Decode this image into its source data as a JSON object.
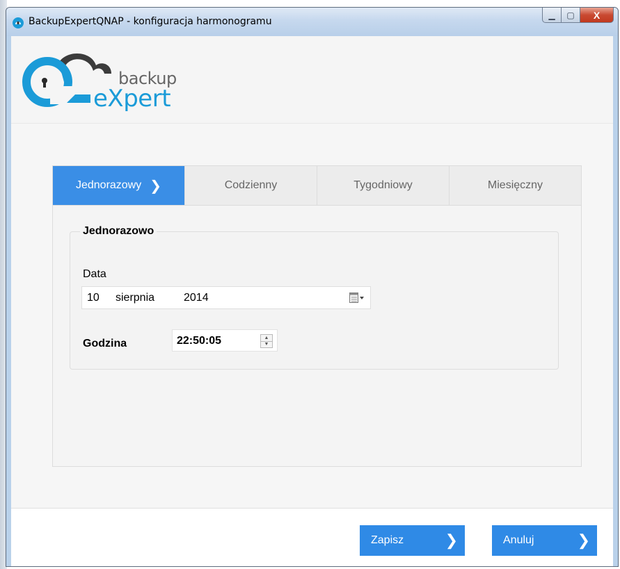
{
  "window": {
    "title": "BackupExpertQNAP - konfiguracja  harmonogramu",
    "controls": {
      "minimize": "▁",
      "maximize": "▢",
      "close": "X"
    }
  },
  "logo": {
    "word1": "backup",
    "word2": "eXpert",
    "color": "#1b9bd8"
  },
  "tabs": [
    {
      "label": "Jednorazowy",
      "active": true
    },
    {
      "label": "Codzienny",
      "active": false
    },
    {
      "label": "Tygodniowy",
      "active": false
    },
    {
      "label": "Miesięczny",
      "active": false
    }
  ],
  "group": {
    "title": "Jednorazowo",
    "date_label": "Data",
    "date": {
      "day": "10",
      "month": "sierpnia",
      "year": "2014"
    },
    "time_label": "Godzina",
    "time": "22:50:05"
  },
  "buttons": {
    "save": "Zapisz",
    "cancel": "Anuluj"
  },
  "colors": {
    "accent": "#3a8ee6",
    "button": "#2f8ae6"
  }
}
